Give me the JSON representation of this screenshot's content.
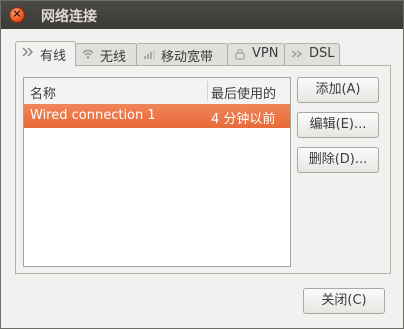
{
  "window": {
    "title": "网络连接"
  },
  "tabs": [
    {
      "label": "有线",
      "icon": "wired-icon"
    },
    {
      "label": "无线",
      "icon": "wireless-icon"
    },
    {
      "label": "移动宽带",
      "icon": "mobile-broadband-icon"
    },
    {
      "label": "VPN",
      "icon": "vpn-icon"
    },
    {
      "label": "DSL",
      "icon": "dsl-icon"
    }
  ],
  "list": {
    "columns": [
      "名称",
      "最后使用的"
    ],
    "rows": [
      {
        "name": "Wired connection 1",
        "last_used": "4 分钟以前",
        "selected": true
      }
    ]
  },
  "buttons": {
    "add": "添加(A)",
    "edit": "编辑(E)...",
    "delete": "删除(D)...",
    "close": "关闭(C)"
  },
  "colors": {
    "selection": "#e86a38",
    "titlebar": "#3c3b37",
    "close_button": "#e9541f"
  }
}
